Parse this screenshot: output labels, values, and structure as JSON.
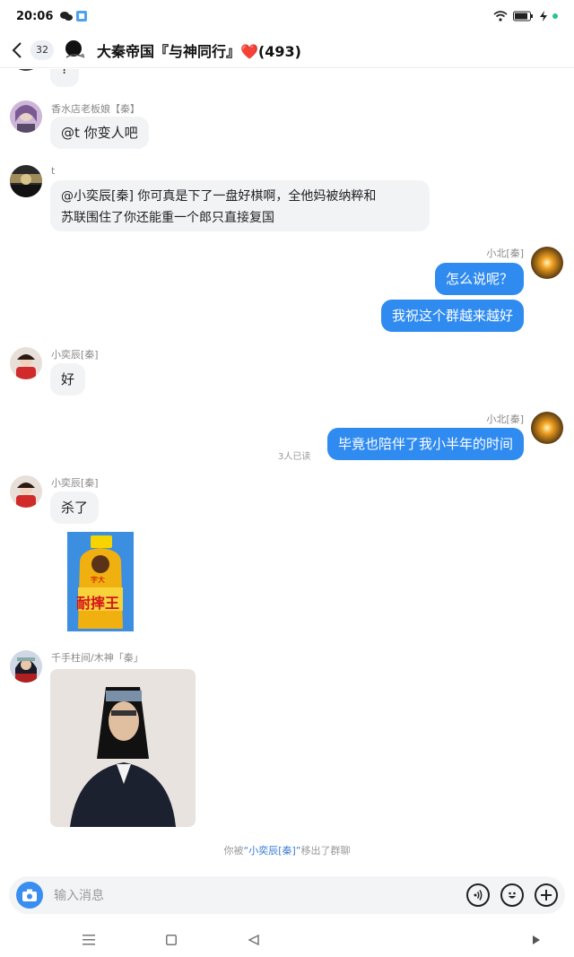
{
  "status_bar": {
    "time": "20:06"
  },
  "header": {
    "unread_count": "32",
    "title": "大秦帝国『与神同行』❤️(493)"
  },
  "messages": {
    "top_cut_text": "?",
    "m1": {
      "sender": "香水店老板娘【秦】",
      "text": "@t 你变人吧"
    },
    "m2": {
      "sender": "t",
      "text_line1": "@小奕辰[秦] 你可真是下了一盘好棋啊，全他妈被纳粹和",
      "text_line2": "苏联围住了你还能重一个郎只直接复国"
    },
    "m3": {
      "sender": "小北[秦]",
      "text1": "怎么说呢？",
      "text2": "我祝这个群越来越好"
    },
    "m4": {
      "sender": "小奕辰[秦]",
      "text": "好"
    },
    "m5": {
      "sender": "小北[秦]",
      "text": "毕竟也陪伴了我小半年的时间",
      "read_receipt": "3人已读"
    },
    "m6": {
      "sender": "小奕辰[秦]",
      "text": "杀了",
      "sticker_text_top": "宇大",
      "sticker_text_main": "耐摔王"
    },
    "m7": {
      "sender": "千手柱间/木神「秦」"
    },
    "system": {
      "prefix": "你被",
      "name": "“小奕辰[秦]”",
      "suffix": "移出了群聊"
    }
  },
  "input": {
    "placeholder": "输入消息"
  },
  "colors": {
    "accent": "#2f8bf0",
    "bubble_in": "#f1f3f5"
  }
}
